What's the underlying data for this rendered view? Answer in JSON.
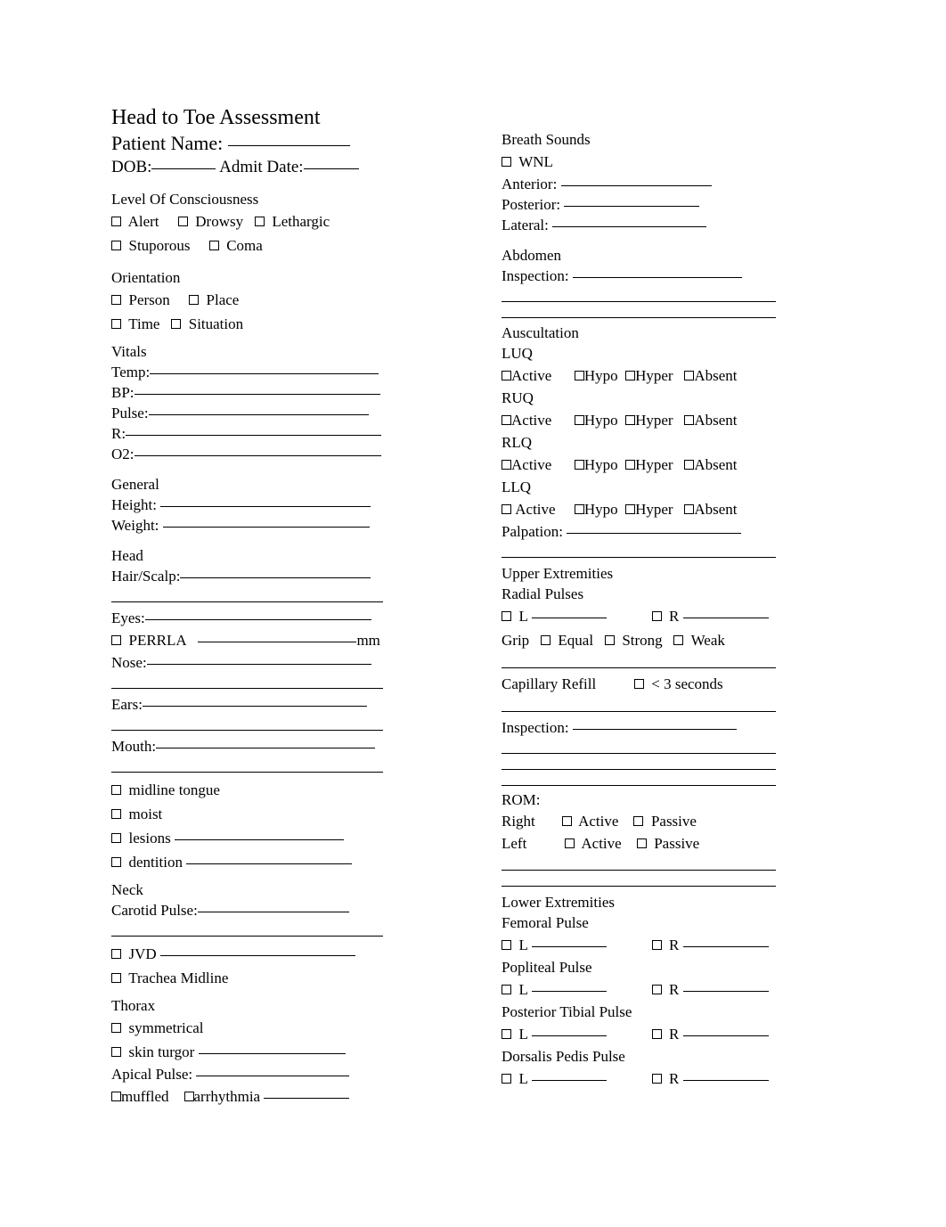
{
  "document": {
    "title": "Head to Toe Assessment",
    "patient_name_label": "Patient Name:",
    "dob_label": "DOB:",
    "admit_date_label": "Admit Date:"
  },
  "left_column": {
    "level_of_consciousness": {
      "heading": "Level Of Consciousness",
      "options_row1": [
        "Alert",
        "Drowsy",
        "Lethargic"
      ],
      "options_row2": [
        "Stuporous",
        "Coma"
      ]
    },
    "orientation": {
      "heading": "Orientation",
      "options_row1": [
        "Person",
        "Place"
      ],
      "options_row2": [
        "Time",
        "Situation"
      ]
    },
    "vitals": {
      "heading": "Vitals",
      "fields": [
        "Temp:",
        "BP:",
        "Pulse:",
        "R:",
        "O2:"
      ]
    },
    "general": {
      "heading": "General",
      "fields": [
        "Height:",
        "Weight:"
      ]
    },
    "head": {
      "heading": "Head",
      "hair_scalp_label": "Hair/Scalp:",
      "eyes_label": "Eyes:",
      "perrla_label": "PERRLA",
      "perrla_unit": "mm",
      "nose_label": "Nose:",
      "ears_label": "Ears:",
      "mouth_label": "Mouth:",
      "mouth_checks": [
        "midline tongue",
        "moist",
        "lesions",
        "dentition"
      ]
    },
    "neck": {
      "heading": "Neck",
      "carotid_pulse_label": "Carotid Pulse:",
      "checks": [
        "JVD",
        "Trachea Midline"
      ]
    },
    "thorax": {
      "heading": "Thorax",
      "checks": [
        "symmetrical",
        "skin turgor"
      ],
      "apical_pulse_label": "Apical Pulse:",
      "heart_sounds": [
        "muffled",
        "arrhythmia"
      ]
    }
  },
  "right_column": {
    "breath_sounds": {
      "heading": "Breath Sounds",
      "wnl_label": "WNL",
      "fields": [
        "Anterior:",
        "Posterior:",
        "Lateral:"
      ]
    },
    "abdomen": {
      "heading": "Abdomen",
      "inspection_label": "Inspection:",
      "auscultation_heading": "Auscultation",
      "quadrants": [
        {
          "name": "LUQ",
          "options": [
            "Active",
            "Hypo",
            "Hyper",
            "Absent"
          ]
        },
        {
          "name": "RUQ",
          "options": [
            "Active",
            "Hypo",
            "Hyper",
            "Absent"
          ]
        },
        {
          "name": "RLQ",
          "options": [
            "Active",
            "Hypo",
            "Hyper",
            "Absent"
          ]
        },
        {
          "name": "LLQ",
          "options": [
            "Active",
            "Hypo",
            "Hyper",
            "Absent"
          ]
        }
      ],
      "palpation_label": "Palpation:"
    },
    "upper_extremities": {
      "heading": "Upper Extremities",
      "radial_pulses_label": "Radial Pulses",
      "side_left": "L",
      "side_right": "R",
      "grip_label": "Grip",
      "grip_options": [
        "Equal",
        "Strong",
        "Weak"
      ],
      "capillary_refill_label": "Capillary Refill",
      "capillary_refill_option": "< 3 seconds",
      "inspection_label": "Inspection:",
      "rom_label": "ROM:",
      "rom_rows": [
        {
          "side": "Right",
          "options": [
            "Active",
            "Passive"
          ]
        },
        {
          "side": "Left",
          "options": [
            "Active",
            "Passive"
          ]
        }
      ]
    },
    "lower_extremities": {
      "heading": "Lower Extremities",
      "side_left": "L",
      "side_right": "R",
      "pulses": [
        "Femoral Pulse",
        "Popliteal Pulse",
        "Posterior Tibial Pulse",
        "Dorsalis Pedis Pulse"
      ]
    }
  }
}
